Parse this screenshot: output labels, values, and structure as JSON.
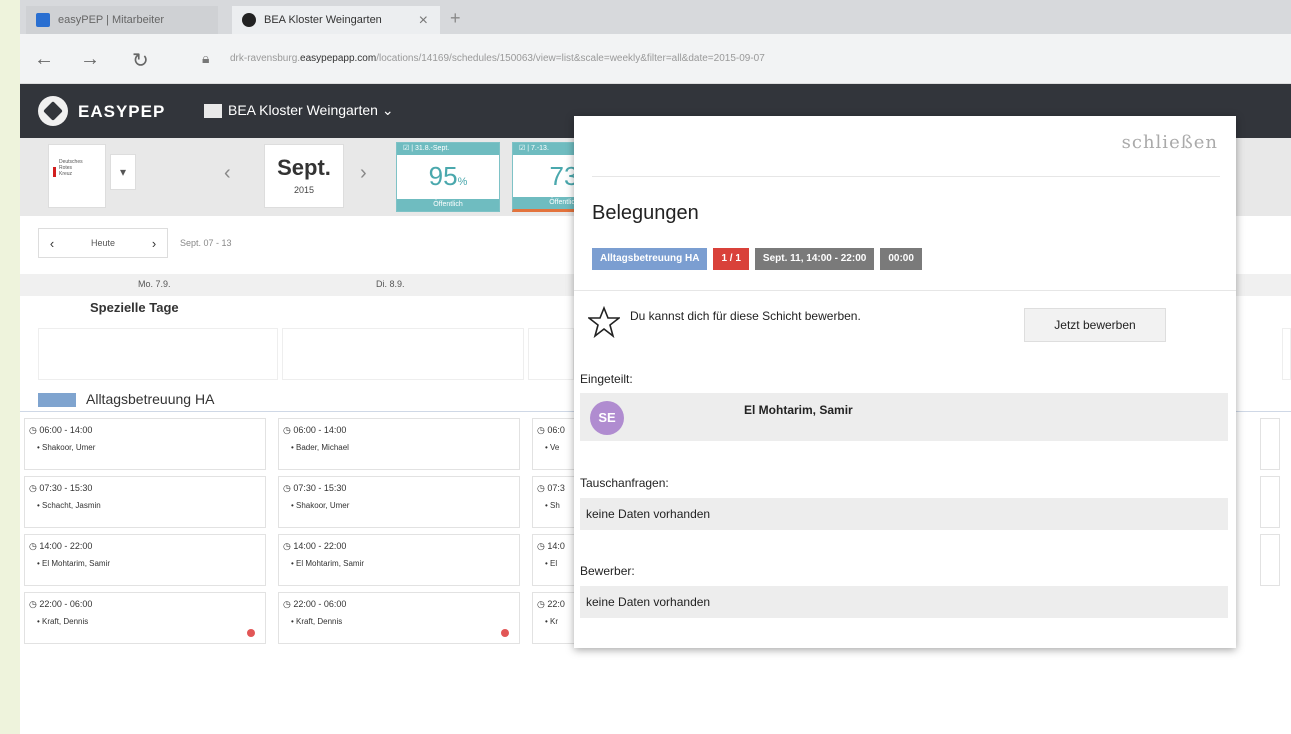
{
  "browser": {
    "tabs": [
      {
        "label": "easyPEP | Mitarbeiter"
      },
      {
        "label": "BEA Kloster Weingarten"
      }
    ],
    "tab_close": "×",
    "new_tab": "+",
    "url_prefix": "drk-ravensburg.",
    "url_domain": "easypepapp.com",
    "url_path": "/locations/14169/schedules/150063/view=list&scale=weekly&filter=all&date=2015-09-07"
  },
  "app": {
    "logo_text": "EASYPEP",
    "location_name": "BEA Kloster Weingarten ⌄"
  },
  "subheader": {
    "org_logo_text": [
      "Deutsches",
      "Rotes",
      "Kreuz"
    ],
    "org_dropdown": "▾",
    "month": "Sept.",
    "year": "2015",
    "weeks": [
      {
        "top": "☑ | 31.8.-Sept.",
        "pct": "95",
        "unit": "%",
        "bottom": "Öffentlich"
      },
      {
        "top": "☑ | 7.-13.",
        "pct": "73",
        "unit": "",
        "bottom": "Öffentlich"
      }
    ]
  },
  "calendar": {
    "today_label": "Heute",
    "range_label": "Sept. 07 - 13",
    "day_headers": [
      "Mo. 7.9.",
      "Di. 8.9."
    ],
    "special_title": "Spezielle Tage",
    "section_title": "Alltagsbetreuung HA",
    "columns": [
      [
        {
          "time": "◷ 06:00 - 14:00",
          "person": "•  Shakoor, Umer",
          "dot": false
        },
        {
          "time": "◷ 07:30 - 15:30",
          "person": "•  Schacht, Jasmin",
          "dot": false
        },
        {
          "time": "◷ 14:00 - 22:00",
          "person": "•  El Mohtarim, Samir",
          "dot": false
        },
        {
          "time": "◷ 22:00 - 06:00",
          "person": "•  Kraft, Dennis",
          "dot": true
        }
      ],
      [
        {
          "time": "◷ 06:00 - 14:00",
          "person": "•  Bader, Michael",
          "dot": false
        },
        {
          "time": "◷ 07:30 - 15:30",
          "person": "•  Shakoor, Umer",
          "dot": false
        },
        {
          "time": "◷ 14:00 - 22:00",
          "person": "•  El Mohtarim, Samir",
          "dot": false
        },
        {
          "time": "◷ 22:00 - 06:00",
          "person": "•  Kraft, Dennis",
          "dot": true
        }
      ],
      [
        {
          "time": "◷ 06:0",
          "person": "•  Ve",
          "dot": false
        },
        {
          "time": "◷ 07:3",
          "person": "•  Sh",
          "dot": false
        },
        {
          "time": "◷ 14:0",
          "person": "•  El",
          "dot": false
        },
        {
          "time": "◷ 22:0",
          "person": "•  Kr",
          "dot": false
        }
      ]
    ]
  },
  "modal": {
    "close_label": "schließen",
    "title": "Belegungen",
    "tags": {
      "category": "Alltagsbetreuung HA",
      "count": "1 / 1",
      "datetime": "Sept. 11, 14:00 - 22:00",
      "duration": "00:00"
    },
    "apply_text": "Du kannst dich für diese Schicht bewerben.",
    "apply_button": "Jetzt bewerben",
    "assigned_label": "Eingeteilt:",
    "assigned_initials": "SE",
    "assigned_name": "El Mohtarim, Samir",
    "swap_label": "Tauschanfragen:",
    "swap_value": "keine Daten vorhanden",
    "applicants_label": "Bewerber:",
    "applicants_value": "keine Daten vorhanden"
  },
  "colors": {
    "header_bg": "#32353b",
    "accent_teal": "#6fbcc0",
    "tag_blue": "#7b9ed1",
    "tag_red": "#d9413a",
    "avatar_purple": "#b08cd0"
  }
}
